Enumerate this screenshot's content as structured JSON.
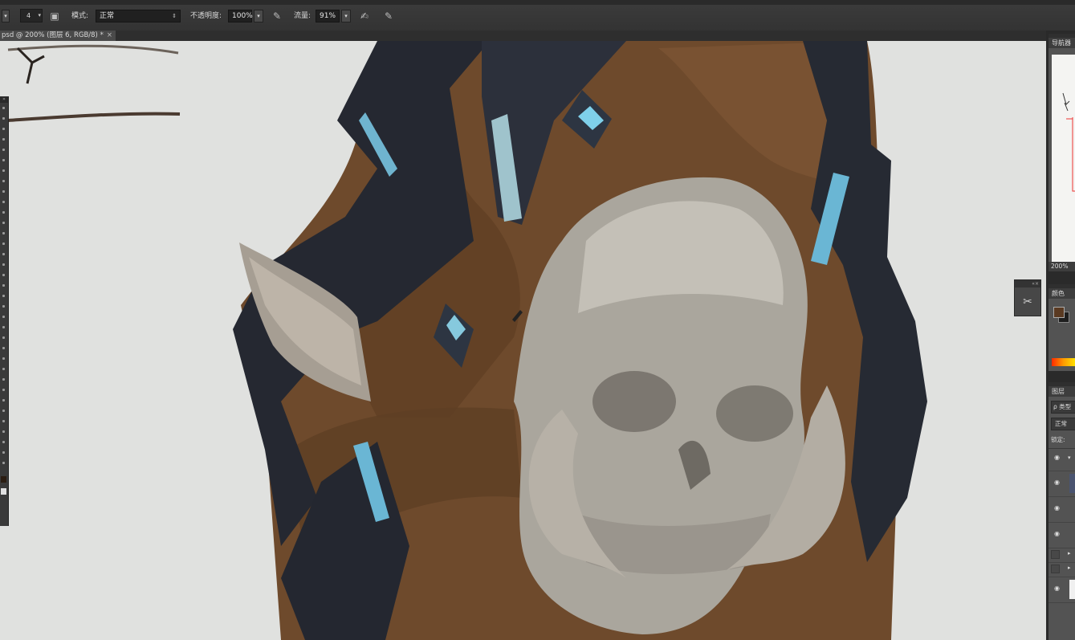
{
  "options_bar": {
    "brush_size": "4",
    "mode_label": "模式:",
    "mode_value": "正常",
    "opacity_label": "不透明度:",
    "opacity_value": "100%",
    "flow_label": "流量:",
    "flow_value": "91%",
    "icons": [
      "brush-preset-icon",
      "brush-panel-icon",
      "pressure-opacity-icon",
      "airbrush-icon",
      "pressure-size-icon"
    ]
  },
  "document_tab": {
    "title": "psd @ 200% (图层 6, RGB/8) *",
    "close": "×"
  },
  "canvas": {
    "background": "#e0e1df",
    "artwork": "painted shield with skull"
  },
  "toolbar": {
    "foreground_color": "#2b1d12",
    "background_color": "#e0e0e0"
  },
  "panels": {
    "navigator": {
      "title": "导航器",
      "zoom": "200%"
    },
    "color": {
      "title": "颜色",
      "foreground": "#5a3a22",
      "background": "#1e1e1e"
    },
    "layers": {
      "title": "图层",
      "filter_label": "ρ 类型",
      "blend_mode": "正常",
      "lock_label": "锁定:"
    }
  },
  "float_panel": {
    "icon": "scissors-icon"
  }
}
